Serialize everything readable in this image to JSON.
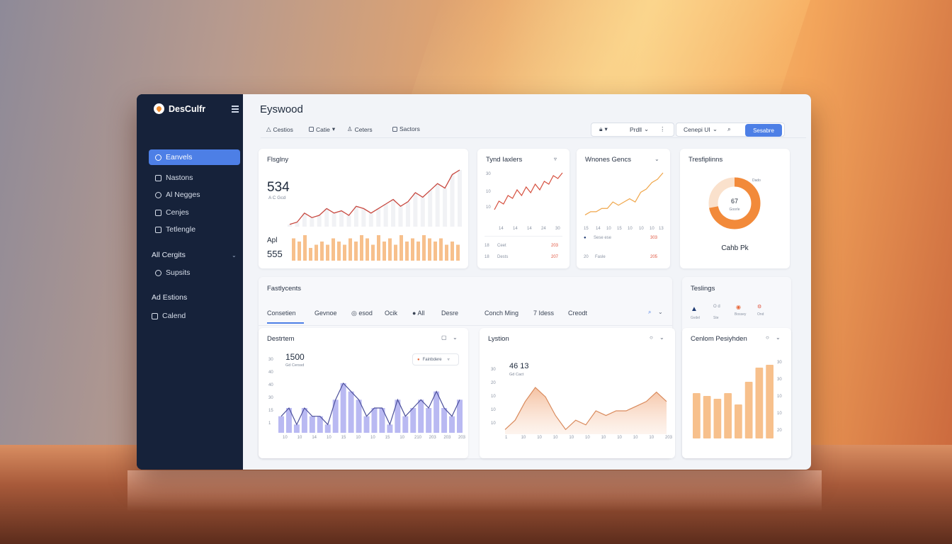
{
  "app": {
    "name": "DesCulfr",
    "title": "Eyswood"
  },
  "sidebar": {
    "items": [
      {
        "label": "Eanvels",
        "active": true
      },
      {
        "label": "Nastons",
        "active": false
      },
      {
        "label": "Al Negges",
        "active": false
      },
      {
        "label": "Cenjes",
        "active": false
      },
      {
        "label": "Tetlengle",
        "active": false
      }
    ],
    "group1": "All Cergits",
    "group1_items": [
      {
        "label": "Supsits"
      }
    ],
    "group2": "Ad Estions",
    "group2_items": [
      {
        "label": "Calend"
      }
    ]
  },
  "toolbar": {
    "left": [
      "Cestios",
      "Catie",
      "Ceters",
      "Sactors"
    ],
    "right_a": "Prdll",
    "right_b": "Cenepi UI",
    "cta": "Sesabre"
  },
  "cards": {
    "flashy": {
      "title": "Flsglny",
      "value": "534",
      "sub": "A C Gcd",
      "label2": "Apl",
      "value2": "555"
    },
    "typal": {
      "title": "Tynd Iaxlers",
      "yticks": [
        "30",
        "10",
        "10"
      ],
      "xticks": [
        "14",
        "14",
        "14",
        "24",
        "30"
      ],
      "rows": [
        {
          "a": "18",
          "b": "Ceet",
          "c": "203"
        },
        {
          "a": "18",
          "b": "Dests",
          "c": "207"
        }
      ]
    },
    "wones": {
      "title": "Wnones Gencs",
      "xticks": [
        "15",
        "14",
        "10",
        "15",
        "10",
        "10",
        "10",
        "13"
      ],
      "rows": [
        {
          "a": "Sese ese",
          "c": "303"
        },
        {
          "a": "20",
          "b": "Fasle",
          "c": "205"
        }
      ]
    },
    "tresfo": {
      "title": "Tresfiplinns",
      "center": "67",
      "center_sub": "Goorle",
      "slice": "Dado",
      "caption": "Cahb Pk",
      "donut": [
        0.72,
        0.28
      ]
    },
    "funnel": {
      "title": "Fastlycents",
      "tabs": [
        "Consetien",
        "Gevnoe",
        "esod",
        "Ocik",
        "All",
        "Desre"
      ]
    },
    "destrin": {
      "title": "Destrtem",
      "value": "1500",
      "sub": "Gd Cerssd",
      "badge": "Fainbdere",
      "yticks": [
        "30",
        "40",
        "40",
        "30",
        "15",
        "1"
      ],
      "xticks": [
        "10",
        "10",
        "14",
        "10",
        "15",
        "10",
        "10",
        "15",
        "10",
        "210",
        "203",
        "203",
        "203"
      ]
    },
    "lystion": {
      "title": "Lystion",
      "tabs": [
        "Conch Ming",
        "7 Idess",
        "Creodt"
      ],
      "value": "46 13",
      "sub": "Gd Cact",
      "yticks": [
        "30",
        "20",
        "10",
        "10",
        "10"
      ],
      "xticks": [
        "1",
        "10",
        "10",
        "10",
        "10",
        "10",
        "10",
        "10",
        "10",
        "10",
        "203"
      ]
    },
    "teslings": {
      "title": "Teslings",
      "chips": [
        {
          "l": "Gvdel",
          "s": "Ste"
        },
        {
          "l": "Bossey"
        },
        {
          "l": "Ond"
        }
      ]
    },
    "cenlom": {
      "title": "Cenlom Pesiyhden",
      "yticks": [
        "30",
        "30",
        "10",
        "10",
        "20"
      ],
      "values": [
        16,
        15,
        14,
        16,
        12,
        20,
        25,
        26
      ]
    }
  },
  "chart_data": [
    {
      "type": "line",
      "name": "flsglny-line",
      "values": [
        4,
        5,
        9,
        7,
        8,
        11,
        9,
        10,
        8,
        12,
        11,
        9,
        11,
        13,
        15,
        12,
        14,
        18,
        16,
        19,
        22,
        20,
        26,
        28
      ]
    },
    {
      "type": "bar",
      "name": "flsglny-bars",
      "values": [
        7,
        6,
        8,
        4,
        5,
        6,
        5,
        7,
        6,
        5,
        7,
        6,
        8,
        7,
        5,
        8,
        6,
        7,
        5,
        8,
        6,
        7,
        6,
        8,
        7,
        6,
        7,
        5,
        6,
        5
      ]
    },
    {
      "type": "line",
      "name": "tynd-iaxlers",
      "values": [
        2,
        5,
        4,
        7,
        6,
        9,
        7,
        10,
        8,
        11,
        9,
        12,
        11,
        14,
        13,
        15
      ]
    },
    {
      "type": "line",
      "name": "wnones-gencs",
      "values": [
        2,
        3,
        3,
        4,
        4,
        6,
        5,
        6,
        7,
        6,
        9,
        10,
        12,
        13,
        15
      ]
    },
    {
      "type": "area",
      "name": "destrtem",
      "values": [
        6,
        7,
        5,
        7,
        6,
        6,
        5,
        8,
        10,
        9,
        8,
        6,
        7,
        7,
        5,
        8,
        6,
        7,
        8,
        7,
        9,
        7,
        6,
        8
      ]
    },
    {
      "type": "area",
      "name": "lystion",
      "values": [
        3,
        5,
        9,
        12,
        10,
        6,
        3,
        5,
        4,
        7,
        6,
        7,
        7,
        8,
        9,
        11,
        9
      ]
    }
  ]
}
